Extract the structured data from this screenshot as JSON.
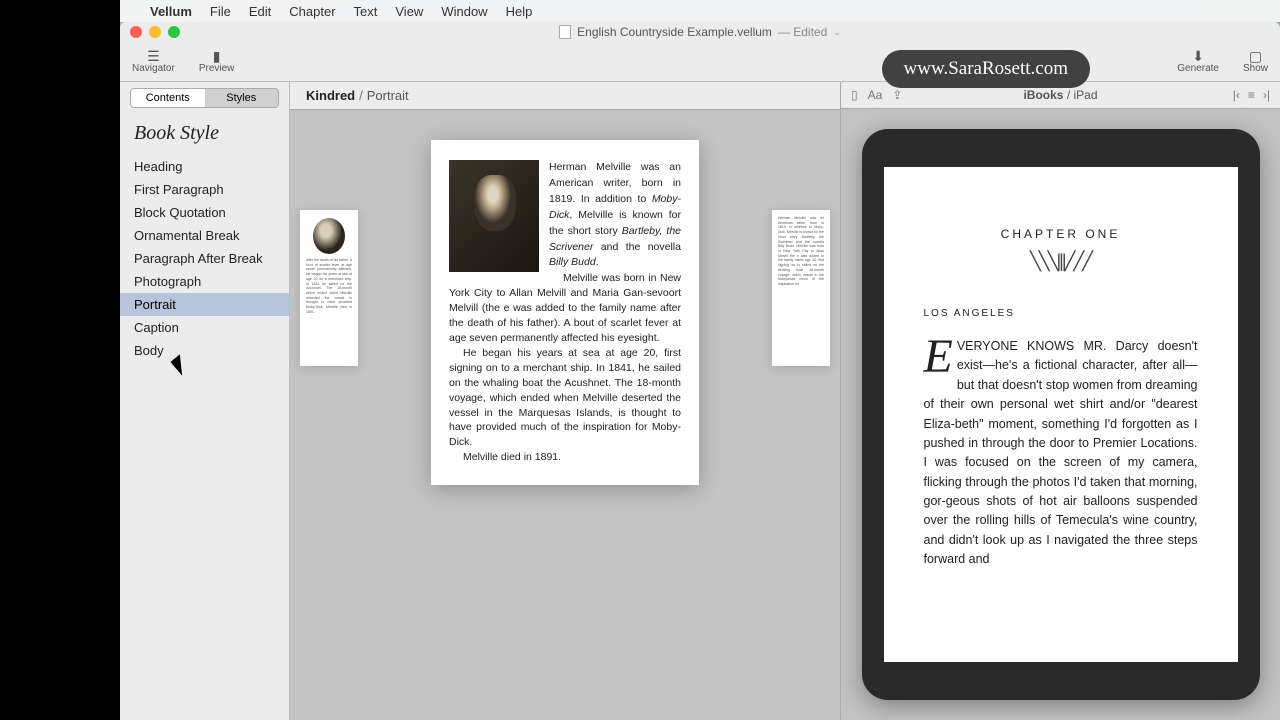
{
  "menubar": {
    "appname": "Vellum",
    "items": [
      "File",
      "Edit",
      "Chapter",
      "Text",
      "View",
      "Window",
      "Help"
    ]
  },
  "window": {
    "title": "English Countryside Example.vellum",
    "edited": "— Edited",
    "brand": "www.SaraRosett.com"
  },
  "toolbar": {
    "navigator": "Navigator",
    "preview": "Preview",
    "generate": "Generate",
    "show": "Show"
  },
  "sidebar": {
    "tabs": {
      "contents": "Contents",
      "styles": "Styles"
    },
    "title": "Book Style",
    "items": [
      "Heading",
      "First Paragraph",
      "Block Quotation",
      "Ornamental Break",
      "Paragraph After Break",
      "Photograph",
      "Portrait",
      "Caption",
      "Body"
    ],
    "selected_index": 6
  },
  "center": {
    "crumb_main": "Kindred",
    "crumb_sub": "Portrait",
    "ghost_l": "after the death of his father. A bout of scarlet fever at age seven permanently affected. He began his years at sea at age 20 on a merchant ship. In 1841 he sailed for the Acushnet. The 18-month which ended when Melville deserted the vessel in thought to have provided Moby-Dick. Melville died in 1891.",
    "ghost_r": "Herman Melville was an American writer, born in 1819. In addition to Moby-Dick, Melville is known for the short story Bartleby, the Scrivener and the novella Billy Budd. Melville was born in New York City to Allan Melvill the e was added to the family name age 20, first signing on to sailed on the whaling boat 18-month voyage, which vessel in the Marquesas much of the inspiration for",
    "p1a": "Herman Melville was an American writer, born in 1819. In addition to ",
    "p1_i1": "Moby-Dick",
    "p1b": ", Melville is known for the short story ",
    "p1_i2": "Bartleby, the Scrivener",
    "p1c": " and the novella ",
    "p1_i3": "Billy Budd",
    "p1d": ".",
    "p2": "Melville was born in New York City to Allan Melvill and Maria Gan-sevoort Melvill (the e was added to the family name after the death of his father). A bout of scarlet fever at age seven permanently affected his eyesight.",
    "p3": "He began his years at sea at age 20, first signing on to a merchant ship. In 1841, he sailed on the whaling boat the Acushnet. The 18-month voyage, which ended when Melville deserted the vessel in the Marquesas Islands, is thought to have provided much of the inspiration for Moby-Dick.",
    "p4": "Melville died in 1891."
  },
  "preview": {
    "device_label": "iBooks",
    "device_sub": "iPad",
    "chapter_title": "CHAPTER ONE",
    "chapter_sub": "LOS ANGELES",
    "dropcap": "E",
    "body": "VERYONE KNOWS MR. Darcy doesn't exist—he's a fictional character, after all—but that doesn't stop women from dreaming of their own personal wet shirt and/or \"dearest Eliza-beth\" moment, something I'd forgotten as I pushed in through the door to Premier Locations. I was focused on the screen of my camera, flicking through the photos I'd taken that morning, gor-geous shots of hot air balloons suspended over the rolling hills of Temecula's wine country, and didn't look up as I navigated the three steps forward and"
  }
}
